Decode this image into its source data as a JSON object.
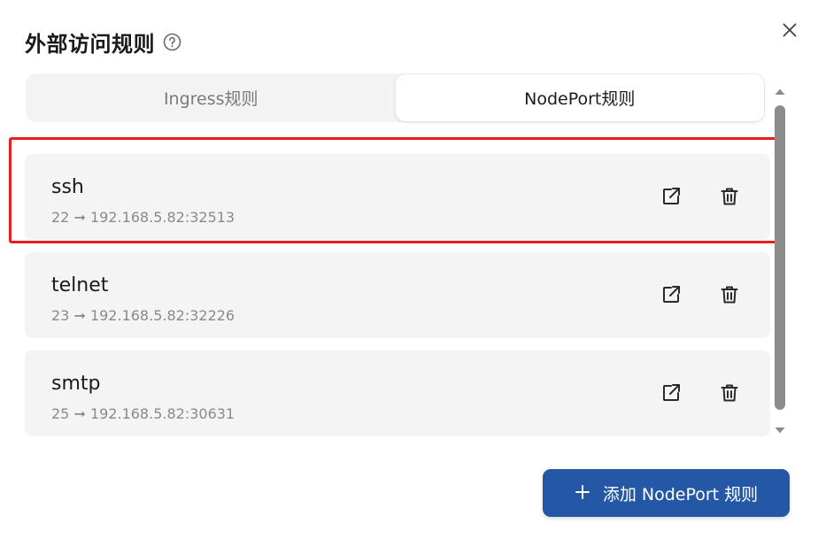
{
  "dialog": {
    "title": "外部访问规则",
    "help_icon": "help-circle-icon",
    "close_icon": "close-icon"
  },
  "tabs": [
    {
      "label": "Ingress规则",
      "active": false
    },
    {
      "label": "NodePort规则",
      "active": true
    }
  ],
  "rules": [
    {
      "name": "ssh",
      "mapping": "22 ➞ 192.168.5.82:32513",
      "highlighted": true
    },
    {
      "name": "telnet",
      "mapping": "23 ➞ 192.168.5.82:32226",
      "highlighted": false
    },
    {
      "name": "smtp",
      "mapping": "25 ➞ 192.168.5.82:30631",
      "highlighted": false
    }
  ],
  "row_icons": {
    "open": "external-link-icon",
    "delete": "trash-icon"
  },
  "add_button": {
    "icon": "plus",
    "label": "添加 NodePort 规则"
  },
  "colors": {
    "accent": "#2458a6",
    "highlight": "#e81f1f",
    "row_bg": "#f4f4f4"
  }
}
